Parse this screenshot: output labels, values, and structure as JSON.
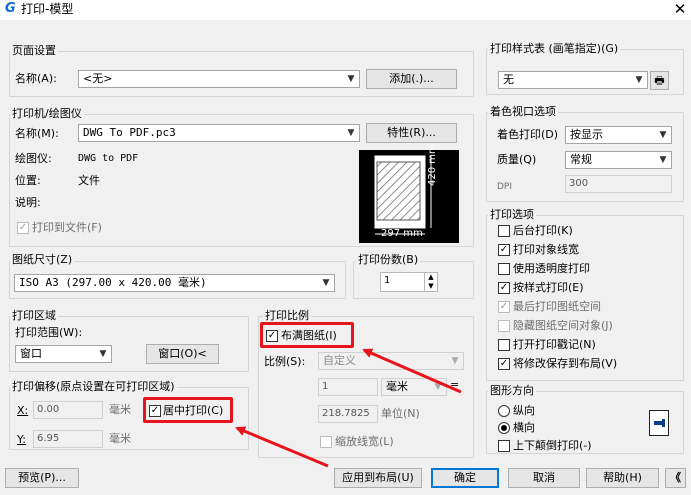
{
  "window": {
    "title": "打印-模型",
    "app_icon_glyph": "G",
    "close_glyph": "✕"
  },
  "page_setup": {
    "group": "页面设置",
    "name_label": "名称(A):",
    "name_value": "<无>",
    "add_button": "添加(.)..."
  },
  "printer": {
    "group": "打印机/绘图仪",
    "name_label": "名称(M):",
    "name_value": "DWG To PDF.pc3",
    "properties_button": "特性(R)...",
    "plotter_label": "绘图仪:",
    "plotter_value": "DWG to PDF",
    "location_label": "位置:",
    "location_value": "文件",
    "description_label": "说明:",
    "print_to_file_label": "打印到文件(F)",
    "print_to_file_checked": true,
    "preview_width_label": "297 mm",
    "preview_height_label": "420 mm"
  },
  "paper_size": {
    "group": "图纸尺寸(Z)",
    "value": "ISO A3 (297.00 x 420.00 毫米)"
  },
  "copies": {
    "group": "打印份数(B)",
    "value": "1"
  },
  "plot_area": {
    "group": "打印区域",
    "range_label": "打印范围(W):",
    "range_value": "窗口",
    "window_button": "窗口(O)<"
  },
  "plot_offset": {
    "group": "打印偏移(原点设置在可打印区域)",
    "x_label": "X:",
    "x_value": "0.00",
    "x_unit": "毫米",
    "y_label": "Y:",
    "y_value": "6.95",
    "y_unit": "毫米",
    "center_label": "居中打印(C)",
    "center_checked": true
  },
  "plot_scale": {
    "group": "打印比例",
    "fit_label": "布满图纸(I)",
    "fit_checked": true,
    "scale_label": "比例(S):",
    "scale_value": "自定义",
    "value1": "1",
    "unit_value": "毫米",
    "equals": "=",
    "value2": "218.7825",
    "unit2_label": "单位(N)",
    "lineweight_label": "缩放线宽(L)"
  },
  "style_table": {
    "group": "打印样式表 (画笔指定)(G)",
    "value": "无"
  },
  "shaded_viewport": {
    "group": "着色视口选项",
    "shade_label": "着色打印(D)",
    "shade_value": "按显示",
    "quality_label": "质量(Q)",
    "quality_value": "常规",
    "dpi_label": "DPI",
    "dpi_value": "300"
  },
  "plot_options": {
    "group": "打印选项",
    "items": [
      {
        "label": "后台打印(K)",
        "checked": false,
        "disabled": false
      },
      {
        "label": "打印对象线宽",
        "checked": true,
        "disabled": false
      },
      {
        "label": "使用透明度打印",
        "checked": false,
        "disabled": false
      },
      {
        "label": "按样式打印(E)",
        "checked": true,
        "disabled": false
      },
      {
        "label": "最后打印图纸空间",
        "checked": true,
        "disabled": true
      },
      {
        "label": "隐藏图纸空间对象(J)",
        "checked": false,
        "disabled": true
      },
      {
        "label": "打开打印戳记(N)",
        "checked": false,
        "disabled": false
      },
      {
        "label": "将修改保存到布局(V)",
        "checked": true,
        "disabled": false
      }
    ]
  },
  "orientation": {
    "group": "图形方向",
    "portrait": "纵向",
    "landscape": "横向",
    "selected": "landscape",
    "upside_down": "上下颠倒打印(-)"
  },
  "footer": {
    "preview_button": "预览(P)...",
    "apply_button": "应用到布局(U)",
    "ok_button": "确定",
    "cancel_button": "取消",
    "help_button": "帮助(H)",
    "collapse_glyph": "《"
  },
  "colors": {
    "highlight": "#e8141b",
    "accent": "#0078d7"
  }
}
